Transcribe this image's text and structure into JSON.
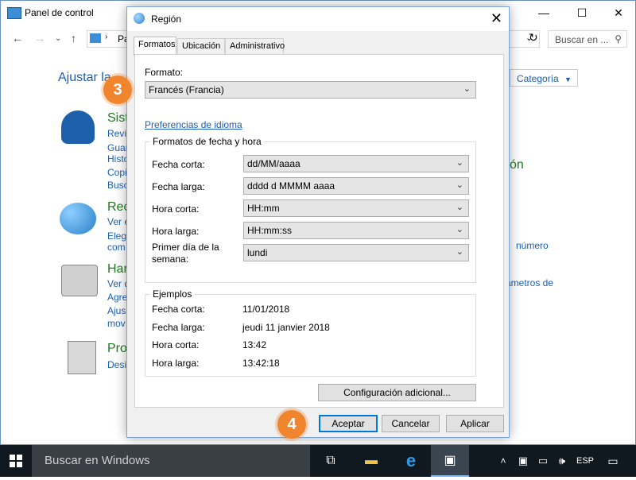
{
  "control_panel": {
    "title": "Panel de control",
    "address_fragment": "Pa",
    "search_placeholder": "Buscar en ...",
    "heading_fragment": "Ajustar la",
    "view_by": "Categoría",
    "groups": [
      {
        "title": "Sist",
        "links": [
          "Revis",
          "Guar",
          "Histo",
          "Copi",
          "Busc"
        ]
      },
      {
        "title": "Rec",
        "links": [
          "Ver e",
          "Elegi",
          "com"
        ]
      },
      {
        "title": "Har",
        "links": [
          "Ver d",
          "Agre",
          "Ajus",
          "mov"
        ]
      },
      {
        "title": "Pro",
        "links": [
          "Desi"
        ]
      }
    ],
    "right_fragments": [
      "ón",
      "número",
      "ámetros de"
    ]
  },
  "dialog": {
    "title": "Región",
    "tabs": [
      "Formatos",
      "Ubicación",
      "Administrativo"
    ],
    "format_label": "Formato:",
    "format_value": "Francés (Francia)",
    "lang_pref_link": "Preferencias de idioma",
    "date_time_group": "Formatos de fecha y hora",
    "fields": [
      {
        "label": "Fecha corta:",
        "value": "dd/MM/aaaa"
      },
      {
        "label": "Fecha larga:",
        "value": "dddd d MMMM aaaa"
      },
      {
        "label": "Hora corta:",
        "value": "HH:mm"
      },
      {
        "label": "Hora larga:",
        "value": "HH:mm:ss"
      },
      {
        "label": "Primer día de la semana:",
        "value": "lundi"
      }
    ],
    "examples_group": "Ejemplos",
    "examples": [
      {
        "label": "Fecha corta:",
        "value": "11/01/2018"
      },
      {
        "label": "Fecha larga:",
        "value": "jeudi 11 janvier 2018"
      },
      {
        "label": "Hora corta:",
        "value": "13:42"
      },
      {
        "label": "Hora larga:",
        "value": "13:42:18"
      }
    ],
    "additional_button": "Configuración adicional...",
    "ok_button": "Aceptar",
    "cancel_button": "Cancelar",
    "apply_button": "Aplicar"
  },
  "steps": {
    "step3": "3",
    "step4": "4"
  },
  "taskbar": {
    "search_placeholder": "Buscar en Windows",
    "lang": "ESP"
  },
  "colors": {
    "accent": "#0078d7",
    "step_badge": "#f0852d",
    "link": "#1a5fb4"
  }
}
